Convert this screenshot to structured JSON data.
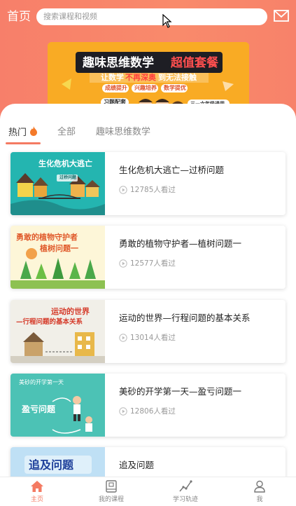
{
  "header": {
    "title": "首页",
    "search_placeholder": "搜索课程和视频",
    "mail_icon": "mail-icon"
  },
  "banner": {
    "title_main": "趣味思维数学",
    "title_badge": "超值套餐",
    "subtitle_a": "让数学",
    "subtitle_b": "不再深奥",
    "subtitle_c": "到无法接触",
    "pills": [
      "成绩提升",
      "兴趣培养",
      "数学提优"
    ],
    "tag_left": "习题配套",
    "tag_right": "三—六年级通用"
  },
  "tabs": [
    {
      "label": "热门",
      "icon": "fire-icon",
      "active": true
    },
    {
      "label": "全部",
      "active": false
    },
    {
      "label": "趣味思维数学",
      "active": false
    }
  ],
  "courses": [
    {
      "title": "生化危机大逃亡—过桥问题",
      "views": "12785人看过",
      "thumb_title": "生化危机大逃亡",
      "thumb_sub": "过桥问题"
    },
    {
      "title": "勇敢的植物守护者—植树问题一",
      "views": "12577人看过",
      "thumb_title": "勇敢的植物守护者",
      "thumb_sub": "植树问题一"
    },
    {
      "title": "运动的世界—行程问题的基本关系",
      "views": "13014人看过",
      "thumb_title": "运动的世界",
      "thumb_sub": "—行程问题的基本关系"
    },
    {
      "title": "美砂的开学第一天—盈亏问题一",
      "views": "12806人看过",
      "thumb_title": "美砂的开学第一天",
      "thumb_sub": "盈亏问题"
    },
    {
      "title": "追及问题",
      "views": "",
      "thumb_title": "追及问题",
      "thumb_sub": ""
    }
  ],
  "tabbar": [
    {
      "label": "主页",
      "icon": "home-icon",
      "active": true
    },
    {
      "label": "我的课程",
      "icon": "book-icon",
      "active": false
    },
    {
      "label": "学习轨迹",
      "icon": "trend-icon",
      "active": false
    },
    {
      "label": "我",
      "icon": "user-icon",
      "active": false
    }
  ],
  "colors": {
    "accent": "#f47a62",
    "header_bg": "#f98a6b",
    "banner_bg": "#fdb92e"
  }
}
